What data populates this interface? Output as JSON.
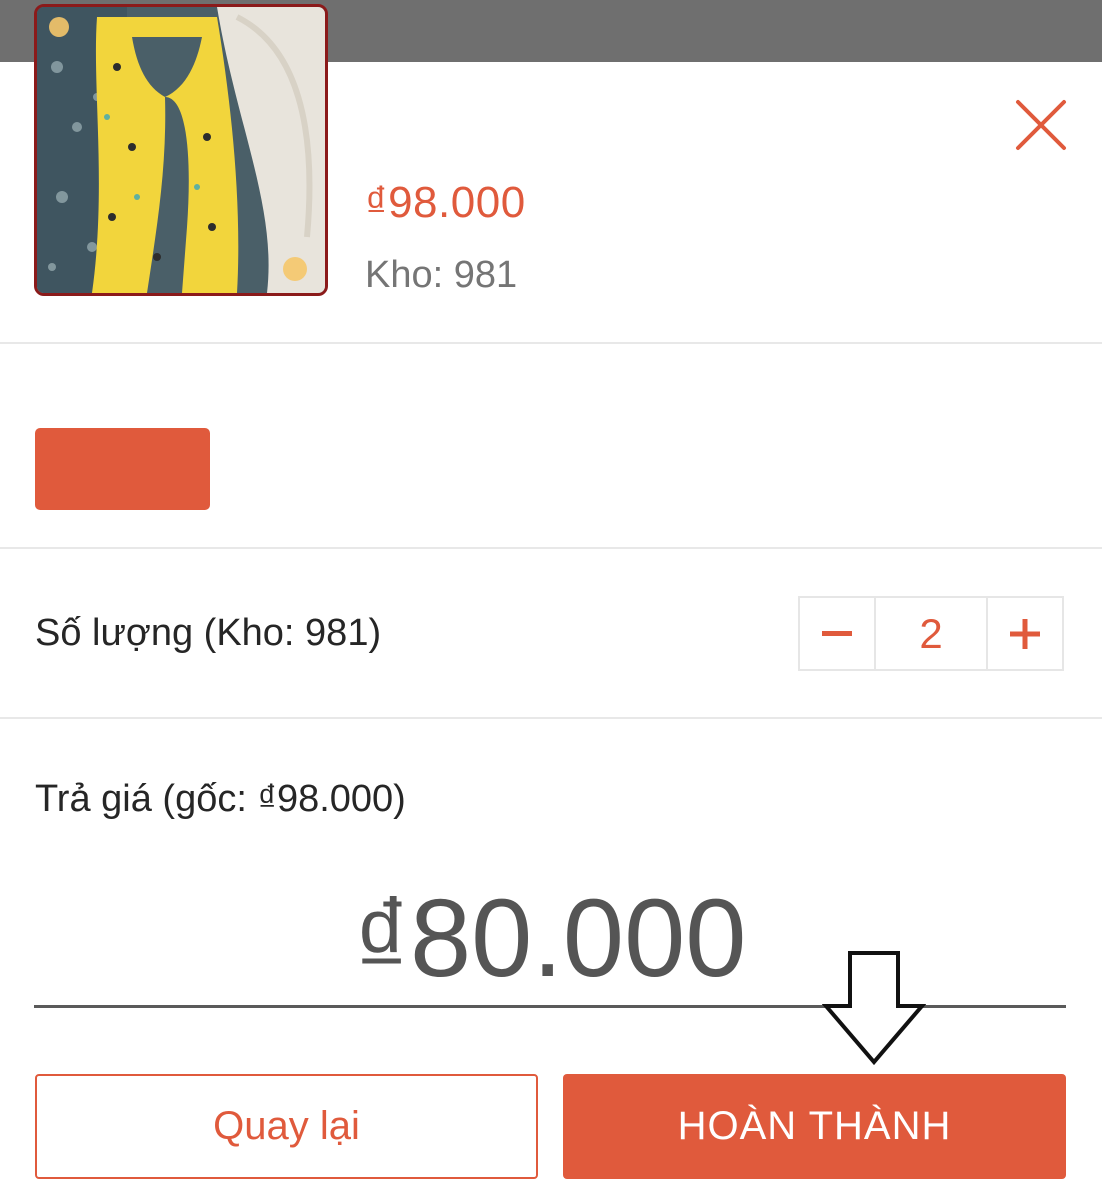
{
  "product": {
    "price": "₫98.000",
    "stock": "Kho: 981",
    "image_icon": "product-photo-yellow-pregnancy-pillow"
  },
  "close": {
    "icon": "close-icon"
  },
  "variant": {
    "selected_color": "#e05a3c"
  },
  "quantity": {
    "label": "Số lượng (Kho: 981)",
    "minus_icon": "minus-icon",
    "value": "2",
    "plus_icon": "plus-icon"
  },
  "offer": {
    "label": "Trả giá (gốc: ₫98.000)",
    "value": "₫80.000"
  },
  "actions": {
    "back_label": "Quay lại",
    "done_label": "HOÀN THÀNH"
  },
  "annotation": {
    "icon": "down-arrow-icon"
  },
  "colors": {
    "accent": "#e05a3c",
    "topbar": "#6f6f6f",
    "text_dark": "#262626",
    "text_muted": "#757575"
  }
}
